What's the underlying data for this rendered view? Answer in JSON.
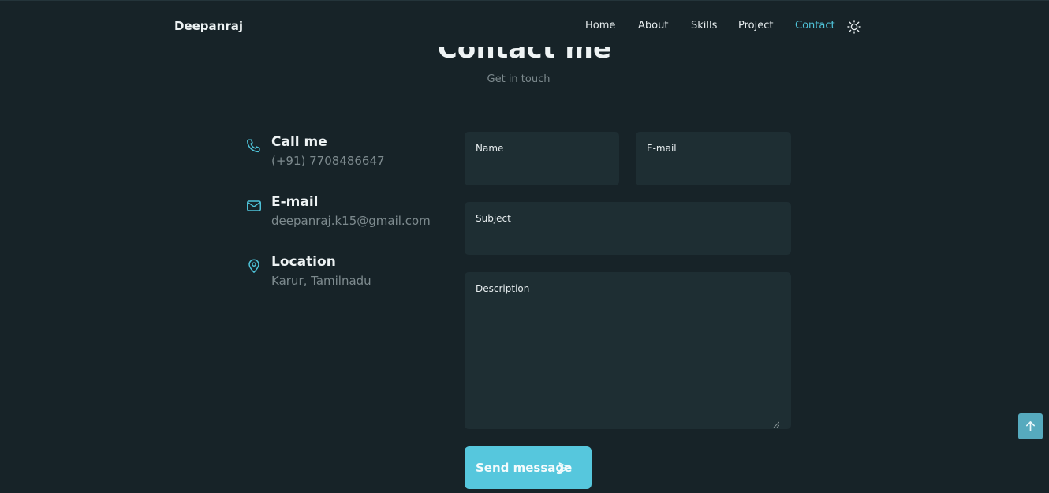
{
  "header": {
    "logo": "Deepanraj",
    "nav": [
      {
        "label": "Home",
        "active": false
      },
      {
        "label": "About",
        "active": false
      },
      {
        "label": "Skills",
        "active": false
      },
      {
        "label": "Project",
        "active": false
      },
      {
        "label": "Contact",
        "active": true
      }
    ],
    "theme_icon": "sun-icon"
  },
  "section": {
    "title": "Contact me",
    "subtitle": "Get in touch"
  },
  "info": [
    {
      "title": "Call me",
      "value": "(+91) 7708486647",
      "icon": "phone-icon"
    },
    {
      "title": "E-mail",
      "value": "deepanraj.k15@gmail.com",
      "icon": "mail-icon"
    },
    {
      "title": "Location",
      "value": "Karur, Tamilnadu",
      "icon": "map-pin-icon"
    }
  ],
  "form": {
    "name_label": "Name",
    "email_label": "E-mail",
    "subject_label": "Subject",
    "description_label": "Description",
    "send_label": "Send message",
    "send_icon": "send-icon"
  },
  "scroll_top_icon": "arrow-up-icon",
  "colors": {
    "background": "#172328",
    "field": "#1e2e33",
    "accent": "#4fc3d9",
    "button": "#56c7dd",
    "muted": "#7d8a8e"
  }
}
